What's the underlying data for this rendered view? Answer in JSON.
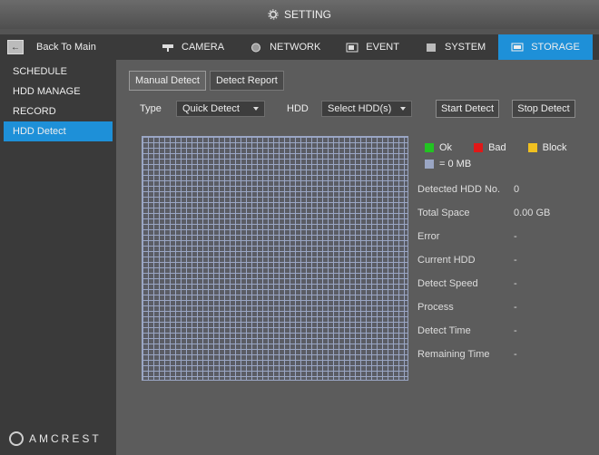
{
  "window": {
    "title": "SETTING"
  },
  "nav": {
    "back_label": "Back To Main",
    "tabs": [
      {
        "label": "CAMERA",
        "icon": "camera-icon",
        "active": false
      },
      {
        "label": "NETWORK",
        "icon": "network-icon",
        "active": false
      },
      {
        "label": "EVENT",
        "icon": "event-icon",
        "active": false
      },
      {
        "label": "SYSTEM",
        "icon": "system-icon",
        "active": false
      },
      {
        "label": "STORAGE",
        "icon": "storage-icon",
        "active": true
      }
    ]
  },
  "sidebar": {
    "items": [
      {
        "label": "SCHEDULE",
        "active": false
      },
      {
        "label": "HDD MANAGE",
        "active": false
      },
      {
        "label": "RECORD",
        "active": false
      },
      {
        "label": "HDD Detect",
        "active": true
      }
    ],
    "logo": "AMCREST"
  },
  "subtabs": [
    {
      "label": "Manual Detect",
      "active": true
    },
    {
      "label": "Detect Report",
      "active": false
    }
  ],
  "controls": {
    "type_label": "Type",
    "type_value": "Quick Detect",
    "hdd_label": "HDD",
    "hdd_value": "Select HDD(s)",
    "start_button": "Start Detect",
    "stop_button": "Stop Detect"
  },
  "legend": {
    "ok": "Ok",
    "bad": "Bad",
    "block": "Block",
    "unit": "= 0 MB",
    "colors": {
      "ok": "#22c322",
      "bad": "#e01818",
      "block": "#f0c020",
      "unit": "#9aa6c4"
    }
  },
  "stats": {
    "detected_hdd_label": "Detected HDD No.",
    "detected_hdd_value": "0",
    "total_space_label": "Total Space",
    "total_space_value": "0.00 GB",
    "error_label": "Error",
    "error_value": "-",
    "current_hdd_label": "Current HDD",
    "current_hdd_value": "-",
    "detect_speed_label": "Detect Speed",
    "detect_speed_value": "-",
    "process_label": "Process",
    "process_value": "-",
    "detect_time_label": "Detect Time",
    "detect_time_value": "-",
    "remaining_time_label": "Remaining Time",
    "remaining_time_value": "-"
  }
}
